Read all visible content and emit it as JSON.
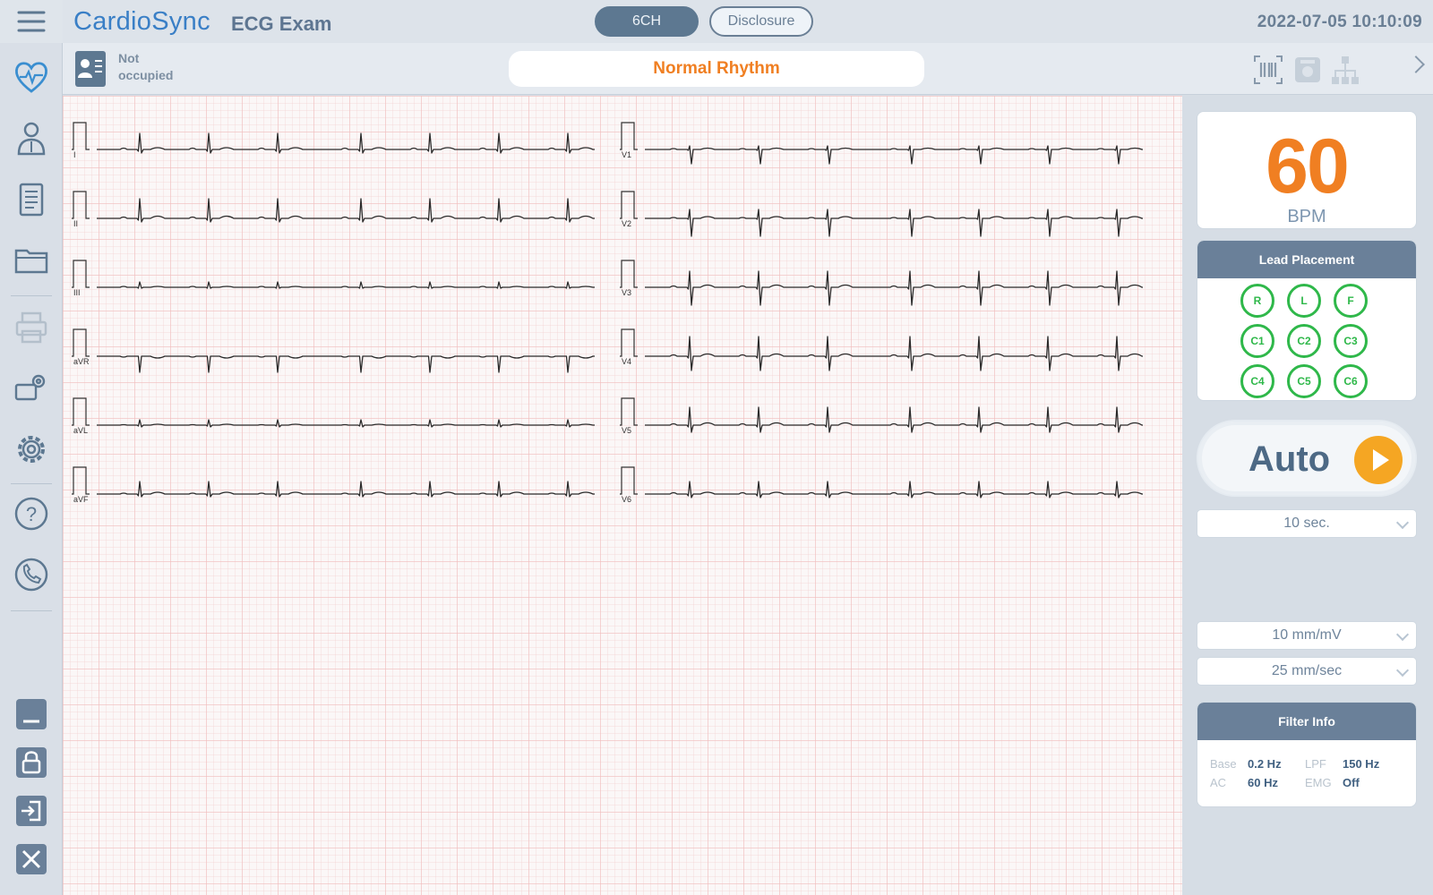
{
  "header": {
    "app_name": "CardioSync",
    "screen_name": "ECG Exam",
    "tabs": [
      {
        "label": "6CH",
        "active": true
      },
      {
        "label": "Disclosure",
        "active": false
      }
    ],
    "datetime": "2022-07-05 10:10:09"
  },
  "sidebar": {
    "items": [
      {
        "icon": "menu-icon"
      },
      {
        "icon": "heart-icon"
      },
      {
        "icon": "patient-icon"
      },
      {
        "icon": "clipboard-icon"
      },
      {
        "icon": "folder-icon"
      },
      {
        "icon": "printer-icon",
        "disabled": true
      },
      {
        "icon": "device-settings-icon"
      },
      {
        "icon": "gear-icon"
      },
      {
        "icon": "help-icon"
      },
      {
        "icon": "phone-icon"
      },
      {
        "icon": "minimize-icon"
      },
      {
        "icon": "lock-icon"
      },
      {
        "icon": "logout-icon"
      },
      {
        "icon": "close-icon"
      }
    ]
  },
  "subheader": {
    "patient_status_line1": "Not",
    "patient_status_line2": "occupied",
    "rhythm": "Normal Rhythm",
    "icons": [
      "barcode-icon",
      "storage-icon",
      "network-icon",
      "chevron-right-icon"
    ]
  },
  "ecg": {
    "leads_left": [
      "I",
      "II",
      "III",
      "aVR",
      "aVL",
      "aVF"
    ],
    "leads_right": [
      "V1",
      "V2",
      "V3",
      "V4",
      "V5",
      "V6"
    ]
  },
  "vitals": {
    "heart_rate": "60",
    "heart_rate_unit": "BPM"
  },
  "lead_placement": {
    "title": "Lead Placement",
    "electrodes": [
      "R",
      "L",
      "F",
      "C1",
      "C2",
      "C3",
      "C4",
      "C5",
      "C6"
    ],
    "color": "#2fb84a"
  },
  "controls": {
    "auto_label": "Auto",
    "duration": "10 sec.",
    "gain": "10 mm/mV",
    "speed": "25 mm/sec"
  },
  "filter_info": {
    "title": "Filter Info",
    "rows": [
      {
        "k1": "Base",
        "v1": "0.2 Hz",
        "k2": "LPF",
        "v2": "150 Hz"
      },
      {
        "k1": "AC",
        "v1": "60 Hz",
        "k2": "EMG",
        "v2": "Off"
      }
    ]
  },
  "colors": {
    "accent_orange": "#f07f22",
    "brand_blue": "#3a7fc6",
    "header_slate": "#5d7891"
  }
}
